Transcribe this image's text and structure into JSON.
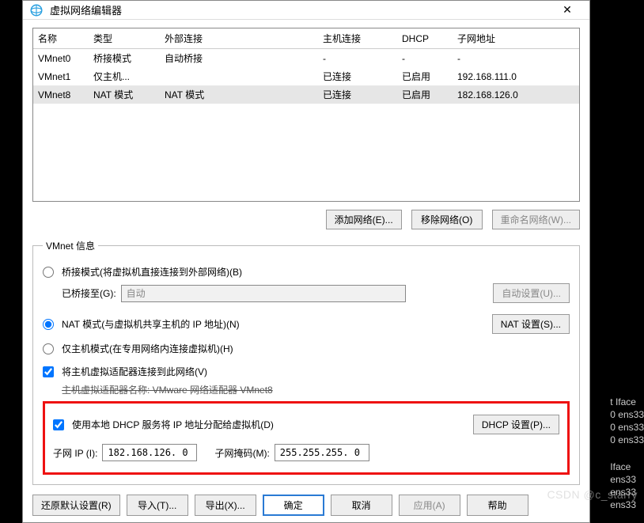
{
  "window": {
    "title": "虚拟网络编辑器",
    "close": "✕"
  },
  "table": {
    "headers": {
      "name": "名称",
      "type": "类型",
      "ext": "外部连接",
      "host": "主机连接",
      "dhcp": "DHCP",
      "subnet": "子网地址"
    },
    "rows": [
      {
        "name": "VMnet0",
        "type": "桥接模式",
        "ext": "自动桥接",
        "host": "-",
        "dhcp": "-",
        "subnet": "-",
        "selected": false
      },
      {
        "name": "VMnet1",
        "type": "仅主机...",
        "ext": "",
        "host": "已连接",
        "dhcp": "已启用",
        "subnet": "192.168.111.0",
        "selected": false
      },
      {
        "name": "VMnet8",
        "type": "NAT 模式",
        "ext": "NAT 模式",
        "host": "已连接",
        "dhcp": "已启用",
        "subnet": "182.168.126.0",
        "selected": true
      }
    ]
  },
  "buttons": {
    "add_net": "添加网络(E)...",
    "remove_net": "移除网络(O)",
    "rename_net": "重命名网络(W)...",
    "auto_set": "自动设置(U)...",
    "nat_set": "NAT 设置(S)...",
    "dhcp_set": "DHCP 设置(P)...",
    "restore": "还原默认设置(R)",
    "import": "导入(T)...",
    "export": "导出(X)...",
    "ok": "确定",
    "cancel": "取消",
    "apply": "应用(A)",
    "help": "帮助"
  },
  "info": {
    "legend": "VMnet 信息",
    "bridge_radio": "桥接模式(将虚拟机直接连接到外部网络)(B)",
    "bridge_to_label": "已桥接至(G):",
    "bridge_to_value": "自动",
    "nat_radio": "NAT 模式(与虚拟机共享主机的 IP 地址)(N)",
    "hostonly_radio": "仅主机模式(在专用网络内连接虚拟机)(H)",
    "conn_host_check": "将主机虚拟适配器连接到此网络(V)",
    "adapter_name_label": "主机虚拟适配器名称: VMware 网络适配器 VMnet8",
    "dhcp_check": "使用本地 DHCP 服务将 IP 地址分配给虚拟机(D)",
    "subnet_ip_label": "子网 IP (I):",
    "subnet_ip_value": "182.168.126. 0",
    "subnet_mask_label": "子网掩码(M):",
    "subnet_mask_value": "255.255.255. 0"
  },
  "terminal": {
    "l1": "t Iface",
    "l2": "0 ens33",
    "l3": "0 ens33",
    "l4": "0 ens33",
    "l5": "Iface",
    "l6": "ens33",
    "l7": "ens33",
    "l8": "ens33"
  },
  "watermark": "CSDN @c_starry"
}
